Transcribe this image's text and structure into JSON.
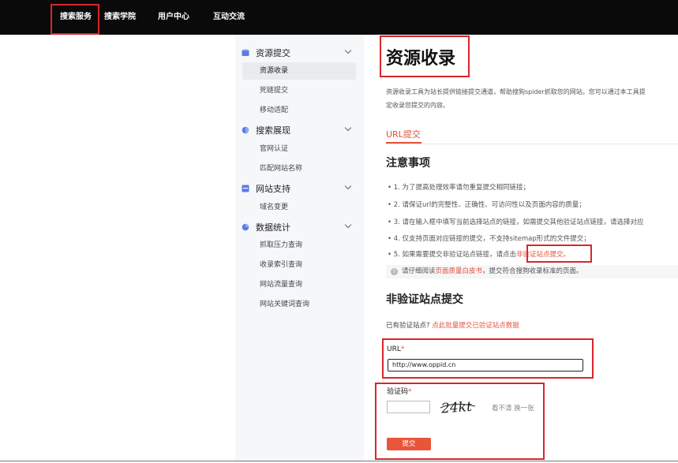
{
  "topnav": [
    "搜索服务",
    "搜索学院",
    "用户中心",
    "互动交流"
  ],
  "sidebar": {
    "groups": [
      {
        "label": "资源提交",
        "icon": "resource-submit-icon",
        "items": [
          "资源收录",
          "死链提交",
          "移动适配"
        ]
      },
      {
        "label": "搜索展现",
        "icon": "search-display-icon",
        "items": [
          "官网认证",
          "匹配网站名称"
        ]
      },
      {
        "label": "网站支持",
        "icon": "site-support-icon",
        "items": [
          "域名变更"
        ]
      },
      {
        "label": "数据统计",
        "icon": "data-stats-icon",
        "items": [
          "抓取压力查询",
          "收录索引查询",
          "网站流量查询",
          "网站关键词查询"
        ]
      }
    ],
    "active_item": "资源收录"
  },
  "main": {
    "title": "资源收录",
    "intro_line1": "资源收录工具为站长提供链接提交通道，帮助搜狗spider抓取您的网站。您可以通过本工具提",
    "intro_line2": "定收录您提交的内容。",
    "tab": "URL提交",
    "notes_title": "注意事项",
    "notes": [
      "• 1. 为了提高处理效率请勿重复提交相同链接；",
      "• 2. 请保证url的完整性、正确性、可访问性以及页面内容的质量；",
      "• 3. 请在输入框中填写当前选择站点的链接，如需提交其他验证站点链接，请选择对应",
      "• 4. 仅支持页面对应链接的提交，不支持sitemap形式的文件提交；"
    ],
    "note5_prefix": "• 5. 如果需要提交非验证站点链接，请点击",
    "note5_link": "非验证站点提交。",
    "tip_prefix": "请仔细阅读",
    "tip_link": "页面质量白皮书",
    "tip_suffix": "，提交符合搜狗收录标准的页面。",
    "section_title": "非验证站点提交",
    "has_verified_prefix": "已有验证站点?",
    "has_verified_link": "点此批量提交已验证站点数据",
    "url_label": "URL",
    "url_value": "http://www.oppid.cn",
    "captcha_label": "验证码",
    "captcha_text": "24kt",
    "refresh_text": "看不清 换一张",
    "submit_label": "提交",
    "required_mark": "*"
  },
  "colors": {
    "accent": "#e5533c",
    "highlight_box": "#d9262b",
    "topbar": "#0a0a0a"
  }
}
